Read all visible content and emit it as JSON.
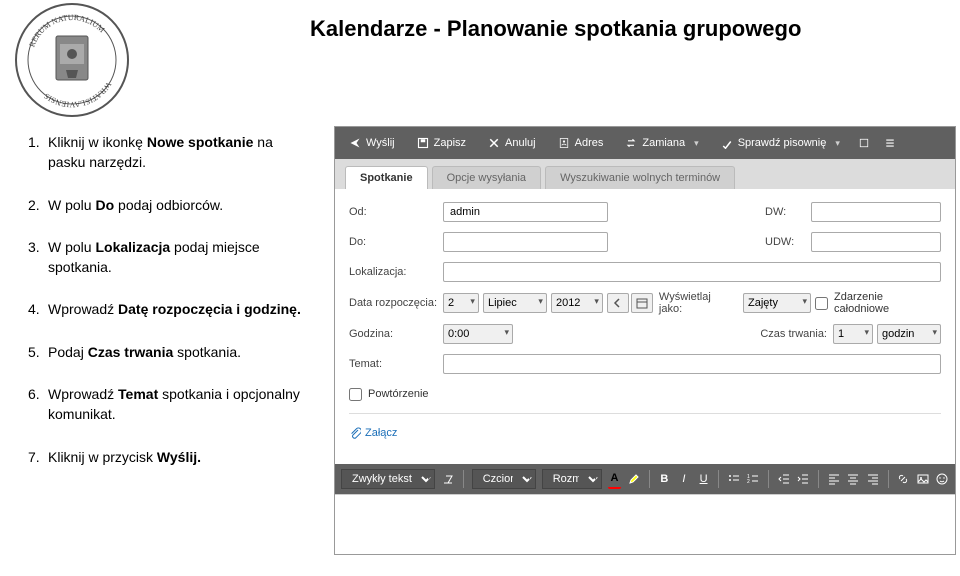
{
  "title": "Kalendarze - Planowanie spotkania grupowego",
  "steps": [
    {
      "pre": "Kliknij w ikonkę ",
      "bold": "Nowe spotkanie",
      "post": " na pasku narzędzi."
    },
    {
      "pre": " W polu ",
      "bold": "Do",
      "post": " podaj odbiorców."
    },
    {
      "pre": "W polu ",
      "bold": "Lokalizacja",
      "post": " podaj miejsce spotkania."
    },
    {
      "pre": "Wprowadź ",
      "bold": "Datę rozpoczęcia i godzinę.",
      "post": ""
    },
    {
      "pre": "Podaj ",
      "bold": "Czas trwania",
      "post": " spotkania."
    },
    {
      "pre": " Wprowadź ",
      "bold": "Temat",
      "post": " spotkania i opcjonalny komunikat."
    },
    {
      "pre": "Kliknij w przycisk ",
      "bold": "Wyślij.",
      "post": ""
    }
  ],
  "toolbar": {
    "send": "Wyślij",
    "save": "Zapisz",
    "cancel": "Anuluj",
    "address": "Adres",
    "swap": "Zamiana",
    "spell": "Sprawdź pisownię"
  },
  "tabs": [
    "Spotkanie",
    "Opcje wysyłania",
    "Wyszukiwanie wolnych terminów"
  ],
  "form": {
    "labels": {
      "from": "Od:",
      "to": "Do:",
      "location": "Lokalizacja:",
      "startdate": "Data rozpoczęcia:",
      "time": "Godzina:",
      "subject": "Temat:",
      "repeat": "Powtórzenie",
      "dw": "DW:",
      "udw": "UDW:",
      "showas": "Wyświetlaj jako:",
      "duration": "Czas trwania:",
      "allday": "Zdarzenie całodniowe"
    },
    "values": {
      "from": "admin",
      "day": "2",
      "month": "Lipiec",
      "year": "2012",
      "time": "0:00",
      "showas": "Zajęty",
      "duration": "1",
      "duration_unit": "godzin"
    }
  },
  "attach": "Załącz",
  "fmt": {
    "style": "Zwykły tekst",
    "font": "Czcionka",
    "size": "Rozmiar"
  }
}
